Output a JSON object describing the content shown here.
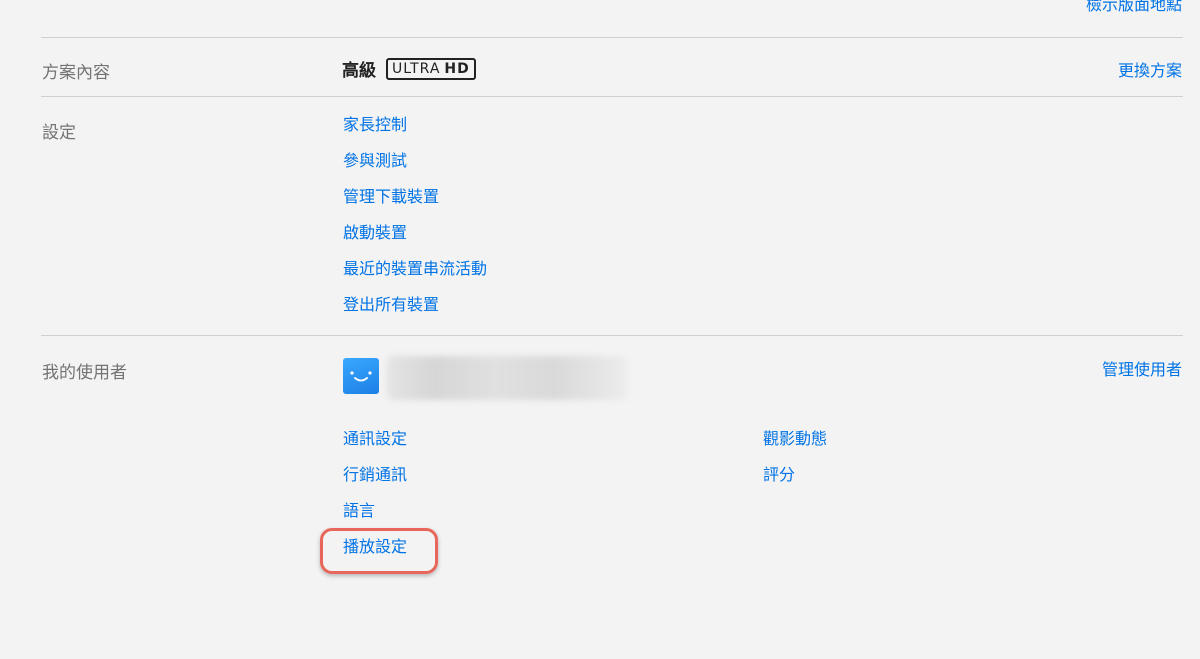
{
  "top": {
    "cut_link_label": "檢示版面地點"
  },
  "plan": {
    "section_label": "方案內容",
    "plan_name": "高級",
    "badge_ultra": "ULTRA",
    "badge_hd": "HD",
    "change_link": "更換方案"
  },
  "settings": {
    "section_label": "設定",
    "items": [
      "家長控制",
      "參與測試",
      "管理下載裝置",
      "啟動裝置",
      "最近的裝置串流活動",
      "登出所有裝置"
    ]
  },
  "profile": {
    "section_label": "我的使用者",
    "manage_link": "管理使用者",
    "avatar_icon": "smiley-avatar-icon",
    "left_links": [
      "通訊設定",
      "行銷通訊",
      "語言",
      "播放設定"
    ],
    "right_links": [
      "觀影動態",
      "評分"
    ]
  },
  "colors": {
    "link": "#0073e6",
    "highlight": "#e8675a",
    "background": "#f3f3f3"
  }
}
